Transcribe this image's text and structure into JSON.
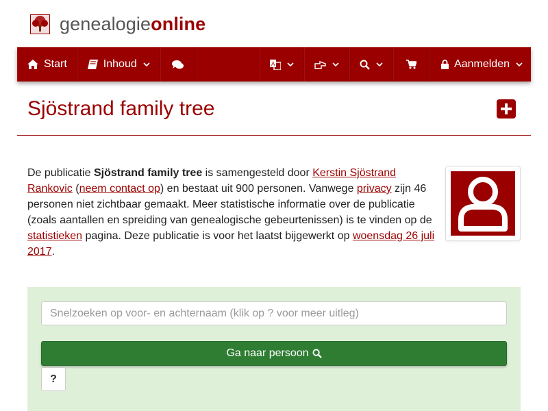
{
  "logo": {
    "part1": "genealogie",
    "part2": "online",
    "icon": "tree-icon"
  },
  "nav": {
    "start": "Start",
    "inhoud": "Inhoud",
    "chat_icon": "comments-icon",
    "language_icon": "language-icon",
    "share_icon": "hand-pointer-icon",
    "search_icon": "search-icon",
    "cart_icon": "shopping-cart-icon",
    "login": "Aanmelden"
  },
  "page": {
    "title": "Sjöstrand family tree",
    "add_icon": "plus-square-icon"
  },
  "description": {
    "t1": "De publicatie ",
    "pub_name": "Sjöstrand family tree",
    "t2": " is samengesteld door ",
    "author": "Kerstin Sjöstrand Rankovic",
    "t3": " (",
    "contact": "neem contact op",
    "t4": ") en bestaat uit 900 personen. Vanwege ",
    "privacy": "privacy",
    "t5": " zijn 46 personen niet zichtbaar gemaakt. Meer statistische informatie over de publicatie (zoals aantallen en spreiding van genealogische gebeurtenissen) is te vinden op de ",
    "stats": "statistieken",
    "t6": " pagina. Deze publicatie is voor het laatst bijgewerkt op ",
    "date": "woensdag 26 juli 2017",
    "t7": "."
  },
  "avatar_icon": "user-icon",
  "search": {
    "placeholder": "Snelzoeken op voor- en achternaam (klik op ? voor meer uitleg)",
    "button": "Ga naar persoon",
    "help": "?"
  },
  "colors": {
    "brand": "#9b0000",
    "panel": "#dff0d8",
    "button": "#2e7d32"
  }
}
